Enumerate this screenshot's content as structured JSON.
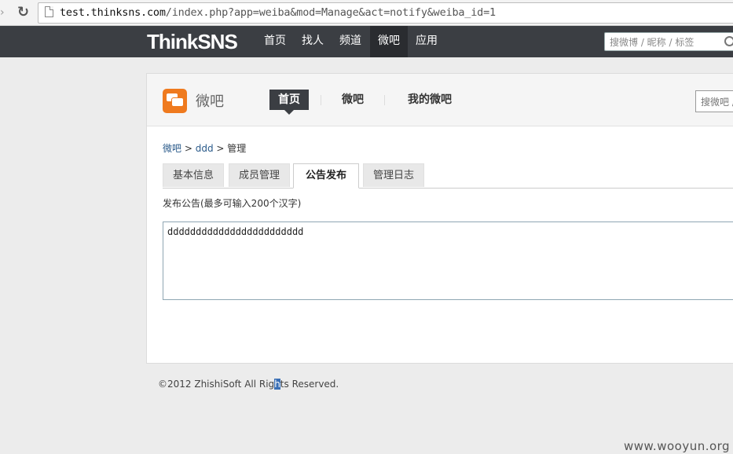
{
  "browser": {
    "url_host": "test.thinksns.com",
    "url_path": "/index.php?app=weiba&mod=Manage&act=notify&weiba_id=1"
  },
  "topnav": {
    "logo": "ThinkSNS",
    "items": [
      "首页",
      "找人",
      "频道",
      "微吧",
      "应用"
    ],
    "active_index": 3,
    "search_placeholder": "搜微博 / 昵称 / 标签"
  },
  "header": {
    "title": "微吧",
    "tabs": [
      "首页",
      "微吧",
      "我的微吧"
    ],
    "active_index": 0,
    "search_placeholder": "搜微吧 /"
  },
  "breadcrumb": {
    "root": "微吧",
    "separator1": " > ",
    "group": "ddd",
    "separator2": " > ",
    "current": "管理"
  },
  "manage_tabs": [
    "基本信息",
    "成员管理",
    "公告发布",
    "管理日志"
  ],
  "manage_active_index": 2,
  "notice": {
    "hint": "发布公告(最多可输入200个汉字)",
    "value": "dddddddddddddddddddddddd"
  },
  "footer": {
    "copyright_pre": "©2012 ZhishiSoft All Rig",
    "copyright_sel": "h",
    "copyright_post": "ts Reserved."
  },
  "watermark": "www.wooyun.org"
}
